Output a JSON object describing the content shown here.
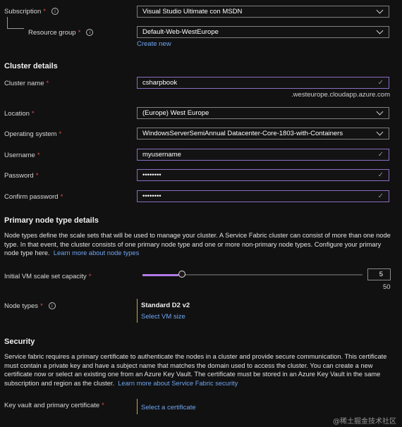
{
  "subscription": {
    "label": "Subscription",
    "value": "Visual Studio Ultimate con MSDN"
  },
  "resource_group": {
    "label": "Resource group",
    "value": "Default-Web-WestEurope",
    "create_new": "Create new"
  },
  "cluster_details": {
    "heading": "Cluster details",
    "cluster_name": {
      "label": "Cluster name",
      "value": "csharpbook",
      "suffix": ".westeurope.cloudapp.azure.com"
    },
    "location": {
      "label": "Location",
      "value": "(Europe) West Europe"
    },
    "os": {
      "label": "Operating system",
      "value": "WindowsServerSemiAnnual Datacenter-Core-1803-with-Containers"
    },
    "username": {
      "label": "Username",
      "value": "myusername"
    },
    "password": {
      "label": "Password",
      "value": "••••••••"
    },
    "confirm_password": {
      "label": "Confirm password",
      "value": "••••••••"
    }
  },
  "primary_node": {
    "heading": "Primary node type details",
    "description": "Node types define the scale sets that will be used to manage your cluster. A Service Fabric cluster can consist of more than one node type. In that event, the cluster consists of one primary node type and one or more non-primary node types. Configure your primary node type here.",
    "learn_more": "Learn more about node types",
    "capacity": {
      "label": "Initial VM scale set capacity",
      "value": "5",
      "max": "50",
      "fraction": 0.1
    },
    "node_types": {
      "label": "Node types",
      "size": "Standard D2 v2",
      "select": "Select VM size"
    }
  },
  "security": {
    "heading": "Security",
    "description": "Service fabric requires a primary certificate to authenticate the nodes in a cluster and provide secure communication. This certificate must contain a private key and have a subject name that matches the domain used to access the cluster. You can create a new certificate now or select an existing one from an Azure Key Vault. The certificate must be stored in an Azure Key Vault in the same subscription and region as the cluster.",
    "learn_more": "Learn more about Service Fabric security",
    "key_vault": {
      "label": "Key vault and primary certificate",
      "select": "Select a certificate"
    }
  },
  "watermark": "@稀土掘金技术社区",
  "colors": {
    "accent": "#8b6ec2",
    "link": "#6ea5f2",
    "required": "#e04c4c",
    "warning_bar": "#c7a74a"
  }
}
